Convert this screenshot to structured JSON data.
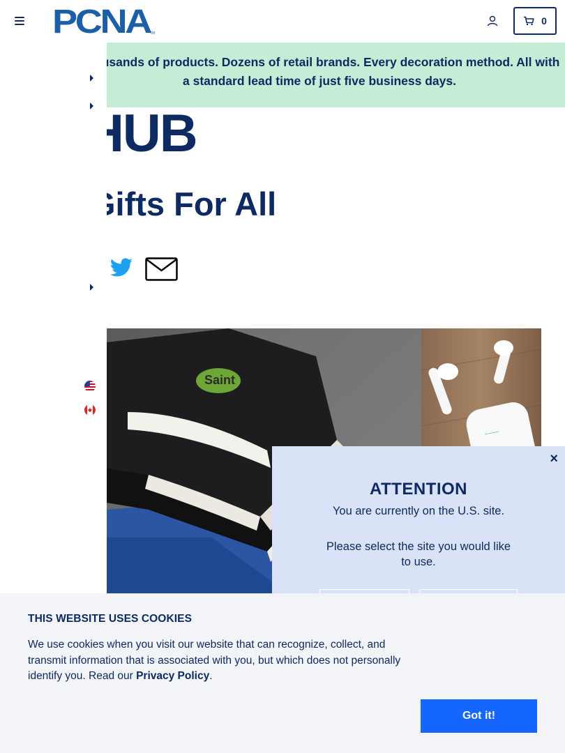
{
  "header": {
    "brand": "PCNA",
    "cart_count": "0"
  },
  "banner": {
    "text": "Thousands of products. Dozens of retail brands. Every decoration method. All with a standard lead time of just five business days."
  },
  "content": {
    "hub_title": "HUB",
    "heading": "Gifts For All"
  },
  "modal": {
    "close": "×",
    "title": "ATTENTION",
    "line1": "You are currently on the U.S. site.",
    "line2": "Please select the site you would like to use."
  },
  "cookie": {
    "title": "THIS WEBSITE USES COOKIES",
    "text_before": "We use cookies when you visit our website that can recognize, collect, and transmit information that is associated with you, but which does not personally identify you. Read our ",
    "link": "Privacy Policy",
    "text_after": ".",
    "button": "Got it!"
  },
  "colors": {
    "navy": "#0d2a62",
    "banner_bg": "#c5edd6",
    "modal_bg": "#d9e2f6",
    "cookie_bg": "#f2f4f8",
    "cookie_button": "#1565ff"
  },
  "icons": [
    "menu-icon",
    "account-icon",
    "cart-icon",
    "caret-right-icon",
    "us-flag-icon",
    "canada-flag-icon",
    "twitter-icon",
    "email-icon",
    "close-icon"
  ]
}
